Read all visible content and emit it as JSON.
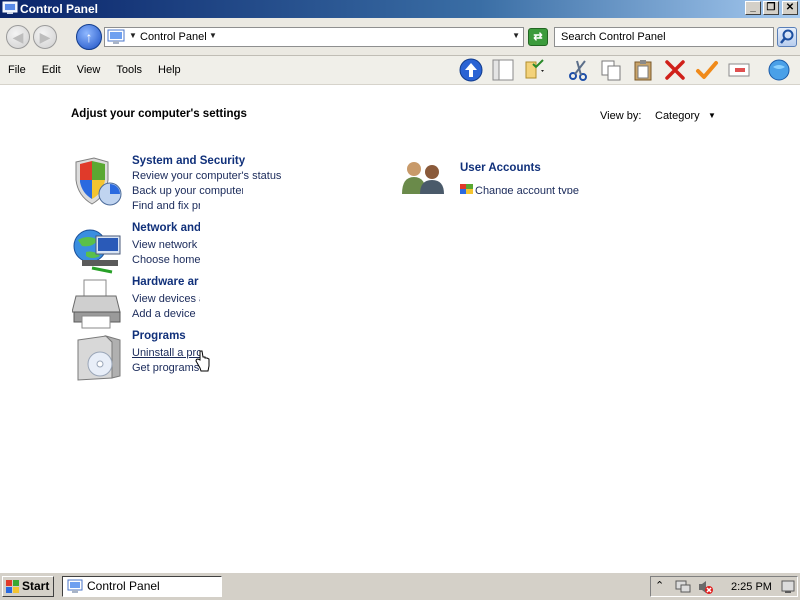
{
  "window": {
    "title": "Control Panel"
  },
  "address": {
    "path": "Control Panel"
  },
  "search": {
    "placeholder": "Search Control Panel"
  },
  "menu": [
    "File",
    "Edit",
    "View",
    "Tools",
    "Help"
  ],
  "content": {
    "heading": "Adjust your computer's settings",
    "view_by_label": "View by:",
    "view_by_value": "Category",
    "categories": [
      {
        "title": "System and Security",
        "links": [
          "Review your computer's status",
          "Back up your computer",
          "Find and fix pr"
        ]
      },
      {
        "title": "Network and",
        "links": [
          "View network s",
          "Choose homeg"
        ]
      },
      {
        "title": "Hardware ar",
        "links": [
          "View devices a",
          "Add a device"
        ]
      },
      {
        "title": "Programs",
        "links": [
          "Uninstall a pro",
          "Get programs"
        ]
      },
      {
        "title": "User Accounts",
        "links": [
          "Change account type"
        ]
      }
    ]
  },
  "taskbar": {
    "start_label": "Start",
    "task_label": "Control Panel",
    "clock": "2:25 PM"
  },
  "colors": {
    "title_bar": "#0a246a",
    "link_title": "#10307a",
    "taskbar": "#d4d0c8"
  }
}
